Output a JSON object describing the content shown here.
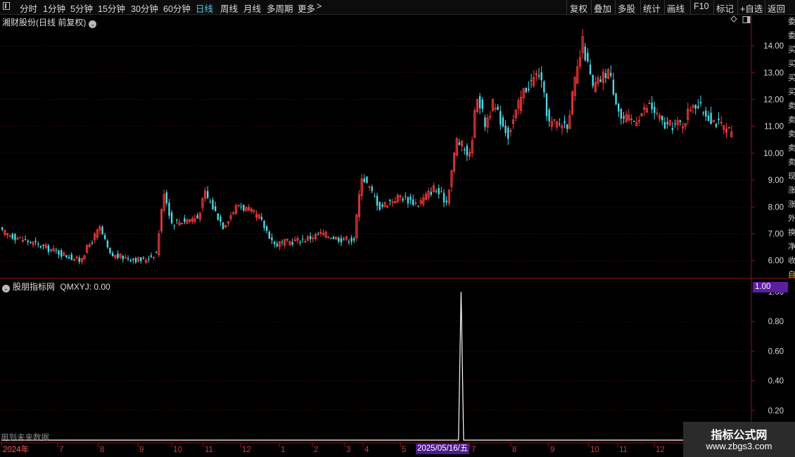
{
  "toolbar": {
    "periods": [
      {
        "label": "分时",
        "active": false
      },
      {
        "label": "1分钟",
        "active": false
      },
      {
        "label": "5分钟",
        "active": false
      },
      {
        "label": "15分钟",
        "active": false
      },
      {
        "label": "30分钟",
        "active": false
      },
      {
        "label": "60分钟",
        "active": false
      },
      {
        "label": "日线",
        "active": true
      },
      {
        "label": "周线",
        "active": false
      },
      {
        "label": "月线",
        "active": false
      },
      {
        "label": "多周期",
        "active": false
      },
      {
        "label": "更多",
        "active": false
      }
    ],
    "more_arrow": ">",
    "actions": [
      "复权",
      "叠加",
      "多股",
      "统计",
      "画线",
      "F10",
      "标记",
      "+自选",
      "返回"
    ]
  },
  "main_panel": {
    "title": "湘财股份(日线 前复权)",
    "chevron": "⌄"
  },
  "indicator_panel": {
    "title": "股朋指标网",
    "indicator_label": "QMXYJ: 0.00",
    "value_badge": "1.00",
    "future_note": "用到未来数据"
  },
  "time_axis": {
    "labels": [
      "2024年",
      "7",
      "8",
      "9",
      "10",
      "11",
      "12",
      "1",
      "2",
      "3",
      "4",
      "5",
      "7",
      "8",
      "9",
      "10",
      "11",
      "12"
    ],
    "cursor_date": "2025/05/16/五"
  },
  "watermark": {
    "line1": "指标公式网",
    "line2": "www.zbgs3.com"
  },
  "right_strip": [
    "委",
    "委",
    "买",
    "买",
    "买",
    "买",
    "卖",
    "卖",
    "卖",
    "卖",
    "卖",
    "现",
    "涨",
    "涨",
    "外",
    "换",
    "净",
    "收",
    "自"
  ],
  "colors": {
    "up": "#ff3c3c",
    "down": "#4fd8e8",
    "axis": "#8b1414",
    "grid": "#5a1010",
    "badge": "#5a1ea0"
  },
  "chart_data": [
    {
      "type": "candlestick",
      "title": "湘财股份(日线 前复权)",
      "y_ticks": [
        "14.00",
        "13.00",
        "12.00",
        "11.00",
        "10.00",
        "9.00",
        "8.00",
        "7.00",
        "6.00"
      ],
      "ylim": [
        5.6,
        14.6
      ],
      "grid": true,
      "close_path": [
        {
          "bar": 0,
          "close": 7.05
        },
        {
          "bar": 15,
          "close": 6.55
        },
        {
          "bar": 30,
          "close": 6.0
        },
        {
          "bar": 38,
          "close": 7.2
        },
        {
          "bar": 42,
          "close": 6.2
        },
        {
          "bar": 55,
          "close": 6.0
        },
        {
          "bar": 60,
          "close": 6.3
        },
        {
          "bar": 63,
          "close": 8.6
        },
        {
          "bar": 66,
          "close": 7.4
        },
        {
          "bar": 76,
          "close": 7.6
        },
        {
          "bar": 79,
          "close": 8.5
        },
        {
          "bar": 86,
          "close": 7.3
        },
        {
          "bar": 92,
          "close": 8.1
        },
        {
          "bar": 100,
          "close": 7.6
        },
        {
          "bar": 106,
          "close": 6.6
        },
        {
          "bar": 118,
          "close": 6.8
        },
        {
          "bar": 124,
          "close": 7.0
        },
        {
          "bar": 132,
          "close": 6.8
        },
        {
          "bar": 137,
          "close": 6.8
        },
        {
          "bar": 140,
          "close": 9.2
        },
        {
          "bar": 147,
          "close": 8.0
        },
        {
          "bar": 155,
          "close": 8.4
        },
        {
          "bar": 162,
          "close": 8.1
        },
        {
          "bar": 168,
          "close": 8.7
        },
        {
          "bar": 173,
          "close": 8.2
        },
        {
          "bar": 177,
          "close": 10.5
        },
        {
          "bar": 182,
          "close": 9.9
        },
        {
          "bar": 185,
          "close": 12.2
        },
        {
          "bar": 188,
          "close": 11.1
        },
        {
          "bar": 191,
          "close": 11.8
        },
        {
          "bar": 197,
          "close": 10.7
        },
        {
          "bar": 203,
          "close": 12.3
        },
        {
          "bar": 209,
          "close": 13.0
        },
        {
          "bar": 213,
          "close": 11.1
        },
        {
          "bar": 220,
          "close": 11.1
        },
        {
          "bar": 223,
          "close": 12.6
        },
        {
          "bar": 226,
          "close": 14.1
        },
        {
          "bar": 230,
          "close": 12.4
        },
        {
          "bar": 236,
          "close": 13.1
        },
        {
          "bar": 241,
          "close": 11.3
        },
        {
          "bar": 246,
          "close": 11.2
        },
        {
          "bar": 252,
          "close": 11.8
        },
        {
          "bar": 258,
          "close": 11.0
        },
        {
          "bar": 265,
          "close": 11.1
        },
        {
          "bar": 269,
          "close": 11.9
        },
        {
          "bar": 276,
          "close": 11.3
        },
        {
          "bar": 284,
          "close": 10.7
        }
      ]
    },
    {
      "type": "line",
      "title": "股朋指标网",
      "series": [
        {
          "name": "QMXYJ",
          "points": [
            {
              "bar": 0,
              "value": 0
            },
            {
              "bar": 178,
              "value": 0
            },
            {
              "bar": 179,
              "value": 1.0
            },
            {
              "bar": 180,
              "value": 0
            },
            {
              "bar": 284,
              "value": 0
            }
          ]
        }
      ],
      "y_ticks": [
        "1.00",
        "0.80",
        "0.60",
        "0.40",
        "0.20"
      ],
      "ylim": [
        0,
        1.0
      ]
    }
  ]
}
